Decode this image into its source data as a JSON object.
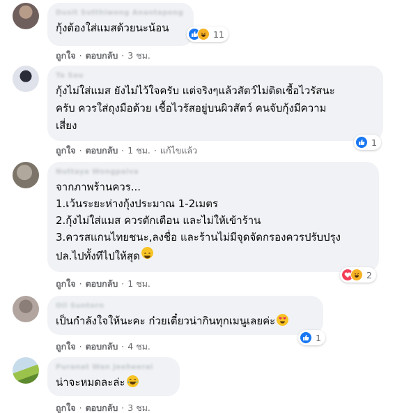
{
  "comments": [
    {
      "name": "Dusit Sutthiwong Anantapong",
      "text_lines": [
        "กุ้งต้องใส่แมสด้วยนะน้อน"
      ],
      "emoji": "",
      "actions": {
        "like": "ถูกใจ",
        "reply": "ตอบกลับ",
        "time": "3 ชม.",
        "edited": ""
      },
      "reactions": {
        "icons": [
          "like-icon",
          "haha-icon"
        ],
        "count": "11"
      }
    },
    {
      "name": "Ta Sau",
      "text_lines": [
        "กุ้งไม่ใส่แมส ยังไม่ไว้ใจครับ แต่จริงๆแล้วสัตว์ไม่ติดเชื้อไวรัสนะ",
        "ครับ ควรใส่ถุงมือด้วย เชื้อไวรัสอยู่บนผิวสัตว์ คนจับกุ้งมีความ",
        "เสี่ยง"
      ],
      "emoji": "",
      "actions": {
        "like": "ถูกใจ",
        "reply": "ตอบกลับ",
        "time": "1 ชม.",
        "edited": "แก้ไขแล้ว"
      },
      "reactions": {
        "icons": [
          "like-icon"
        ],
        "count": "1"
      }
    },
    {
      "name": "Nuttaya Wongpaiva",
      "text_lines": [
        "จากภาพร้านควร...",
        "1.เว้นระยะห่างกุ้งประมาณ 1-2เมตร",
        "2.กุ้งไม่ใส่แมส ควรตักเตือน และไม่ให้เข้าร้าน",
        "3.ควรสแกนไทยชนะ,ลงชื่อ และร้านไม่มีจุดจัดกรองควรปรับปรุง",
        "ปล.ไปทั้งทีไปให้สุด"
      ],
      "emoji": "smile-emoji",
      "actions": {
        "like": "ถูกใจ",
        "reply": "ตอบกลับ",
        "time": "1 ชม.",
        "edited": ""
      },
      "reactions": {
        "icons": [
          "love-icon",
          "haha-icon"
        ],
        "count": "2"
      }
    },
    {
      "name": "Oil Suntorn",
      "text_lines": [
        "เป็นกำลังใจให้นะคะ ก๋วยเตี๋ยวน่ากินทุกเมนูเลยค่ะ"
      ],
      "emoji": "heart-eyes-emoji",
      "actions": {
        "like": "ถูกใจ",
        "reply": "ตอบกลับ",
        "time": "4 ชม.",
        "edited": ""
      },
      "reactions": {
        "icons": [
          "like-icon"
        ],
        "count": "1"
      }
    },
    {
      "name": "Puranat Wan Jeeheerai",
      "text_lines": [
        "น่าจะหมดละล่ะ"
      ],
      "emoji": "tears-of-joy-emoji",
      "actions": {
        "like": "ถูกใจ",
        "reply": "ตอบกลับ",
        "time": "3 ชม.",
        "edited": ""
      },
      "reactions": {
        "icons": [],
        "count": ""
      }
    }
  ],
  "colors": {
    "bubble": "#f0f2f5",
    "meta_text": "#65676b",
    "like_blue": "#1877f2",
    "love_red": "#f33e58",
    "haha_yellow": "#f7b125"
  }
}
